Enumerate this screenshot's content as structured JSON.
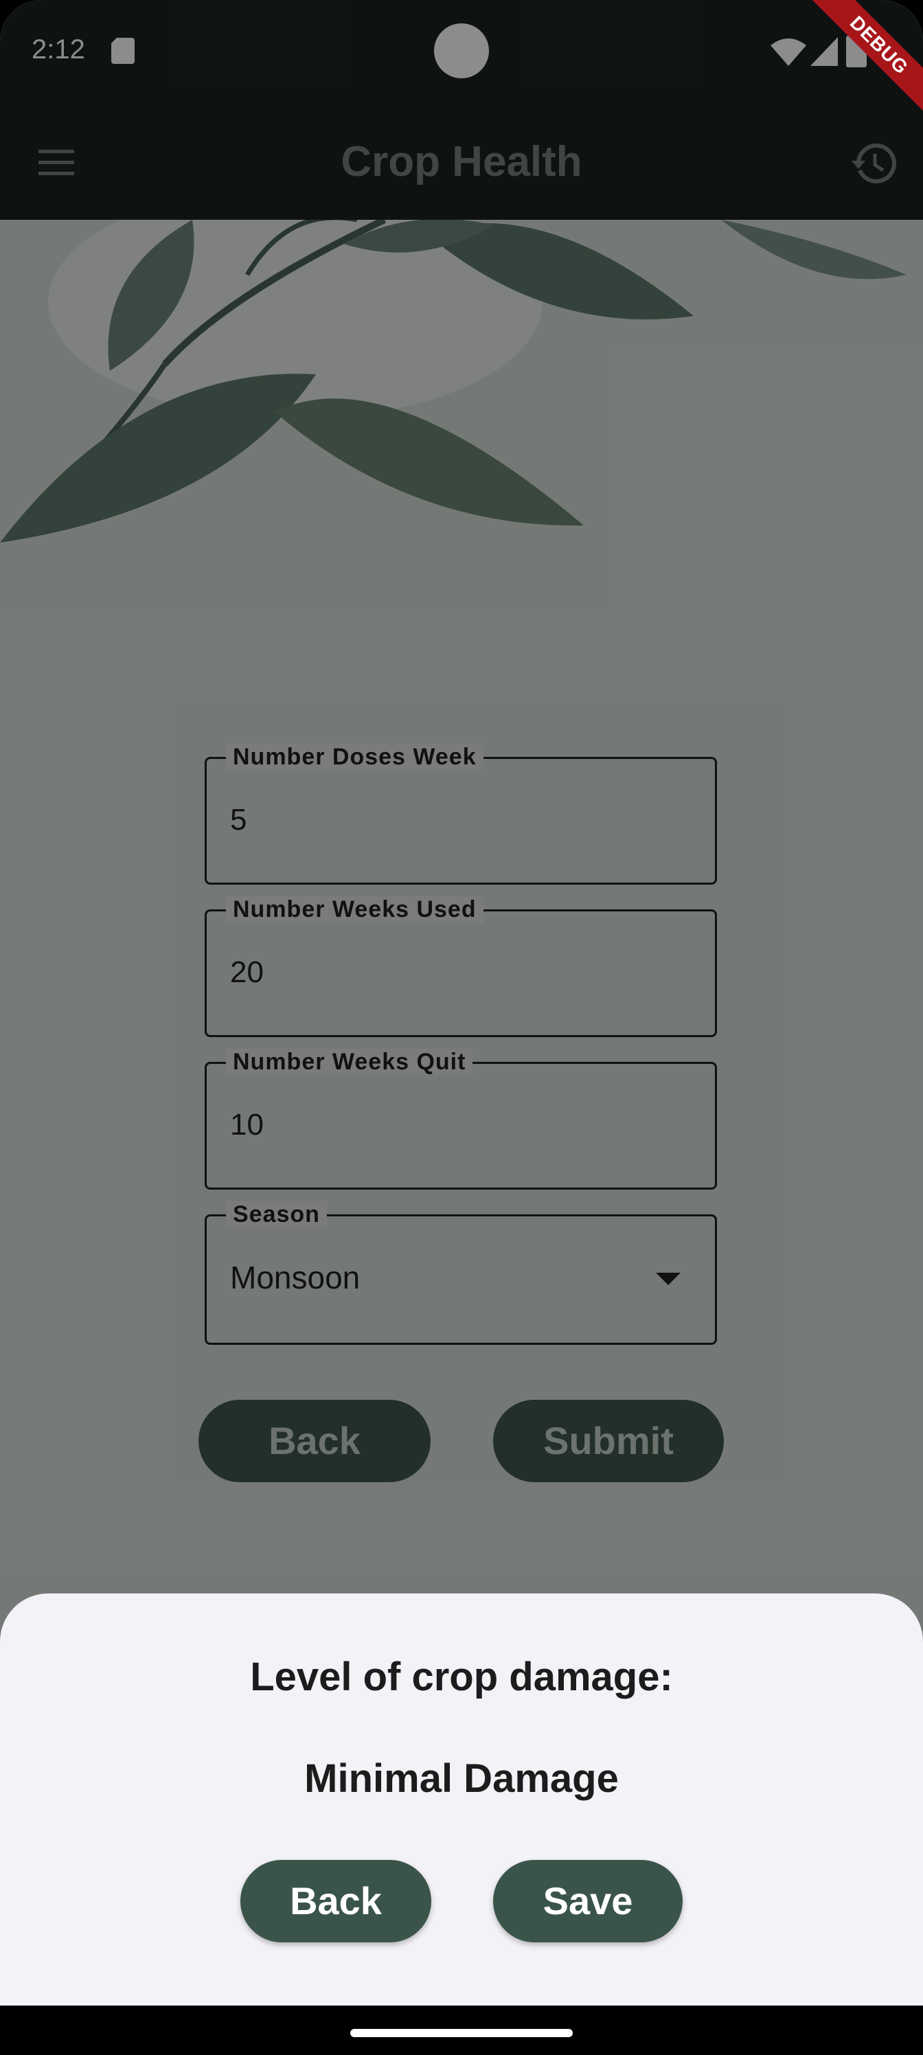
{
  "status_bar": {
    "time": "2:12"
  },
  "debug_banner": "DEBUG",
  "app_bar": {
    "title": "Crop Health"
  },
  "form": {
    "fields": [
      {
        "label": "Number Doses Week",
        "value": "5"
      },
      {
        "label": "Number Weeks Used",
        "value": "20"
      },
      {
        "label": "Number Weeks Quit",
        "value": "10"
      }
    ],
    "season": {
      "label": "Season",
      "value": "Monsoon"
    },
    "back_label": "Back",
    "submit_label": "Submit"
  },
  "sheet": {
    "title": "Level of crop damage:",
    "result": "Minimal Damage",
    "back_label": "Back",
    "save_label": "Save"
  },
  "colors": {
    "app_bar": "#1b231f",
    "sheet_button": "#3a5449",
    "sheet_background": "#f3f2f7",
    "debug_banner": "#a8161a"
  }
}
